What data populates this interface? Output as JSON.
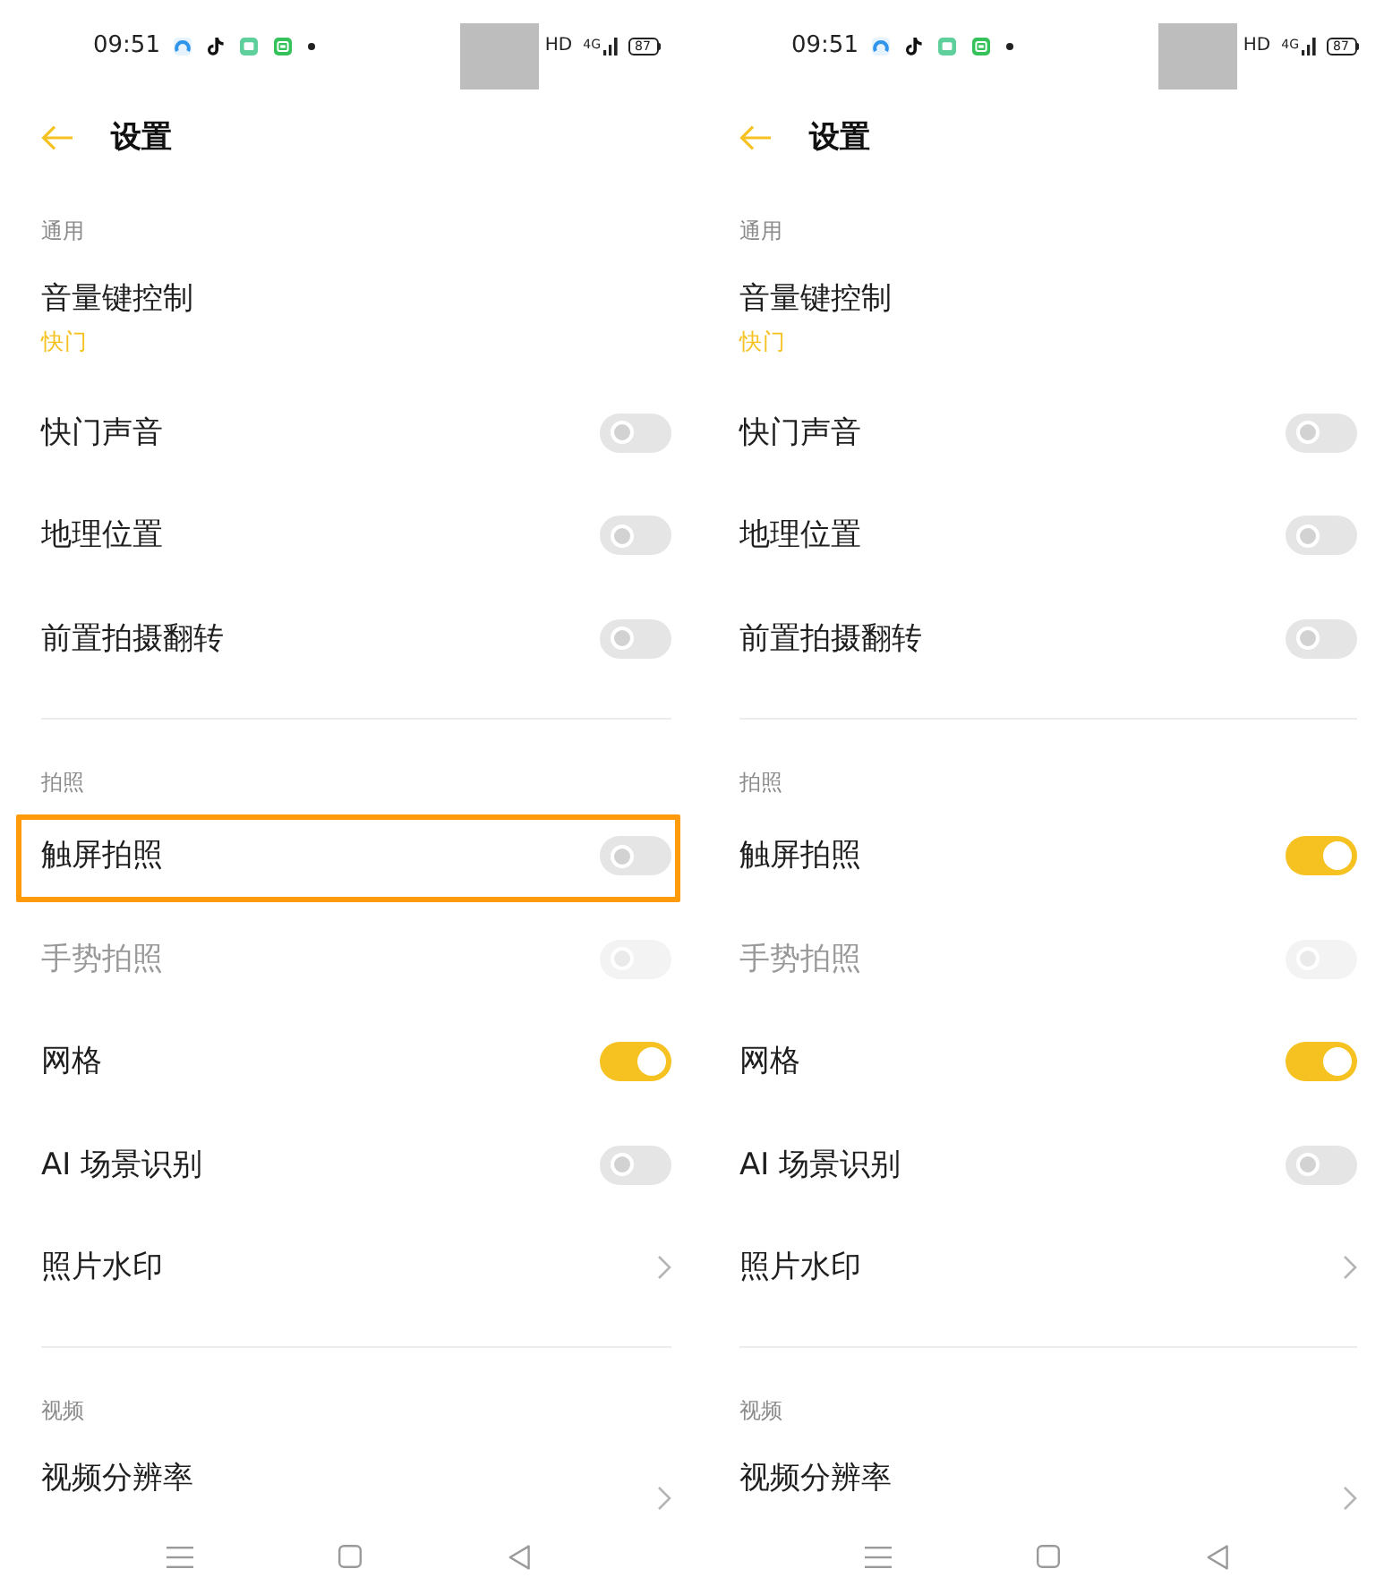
{
  "screens": [
    {
      "status_bar": {
        "time": "09:51",
        "hd": "HD",
        "network": "4G",
        "battery": "87"
      },
      "header": {
        "title": "设置"
      },
      "sections": [
        {
          "title": "通用",
          "items": [
            {
              "kind": "choice",
              "label": "音量键控制",
              "value": "快门",
              "disabled": false,
              "highlighted": false
            },
            {
              "kind": "switch",
              "label": "快门声音",
              "on": false,
              "disabled": false,
              "highlighted": false
            },
            {
              "kind": "switch",
              "label": "地理位置",
              "on": false,
              "disabled": false,
              "highlighted": false
            },
            {
              "kind": "switch",
              "label": "前置拍摄翻转",
              "on": false,
              "disabled": false,
              "highlighted": false
            }
          ]
        },
        {
          "title": "拍照",
          "items": [
            {
              "kind": "switch",
              "label": "触屏拍照",
              "on": false,
              "disabled": false,
              "highlighted": true
            },
            {
              "kind": "switch",
              "label": "手势拍照",
              "on": false,
              "disabled": true,
              "highlighted": false
            },
            {
              "kind": "switch",
              "label": "网格",
              "on": true,
              "disabled": false,
              "highlighted": false
            },
            {
              "kind": "switch",
              "label": "AI 场景识别",
              "on": false,
              "disabled": false,
              "highlighted": false
            },
            {
              "kind": "link",
              "label": "照片水印",
              "disabled": false,
              "highlighted": false
            }
          ]
        },
        {
          "title": "视频",
          "items": [
            {
              "kind": "detail",
              "label": "视频分辨率",
              "disabled": false,
              "highlighted": false
            }
          ]
        }
      ]
    },
    {
      "status_bar": {
        "time": "09:51",
        "hd": "HD",
        "network": "4G",
        "battery": "87"
      },
      "header": {
        "title": "设置"
      },
      "sections": [
        {
          "title": "通用",
          "items": [
            {
              "kind": "choice",
              "label": "音量键控制",
              "value": "快门",
              "disabled": false,
              "highlighted": false
            },
            {
              "kind": "switch",
              "label": "快门声音",
              "on": false,
              "disabled": false,
              "highlighted": false
            },
            {
              "kind": "switch",
              "label": "地理位置",
              "on": false,
              "disabled": false,
              "highlighted": false
            },
            {
              "kind": "switch",
              "label": "前置拍摄翻转",
              "on": false,
              "disabled": false,
              "highlighted": false
            }
          ]
        },
        {
          "title": "拍照",
          "items": [
            {
              "kind": "switch",
              "label": "触屏拍照",
              "on": true,
              "disabled": false,
              "highlighted": false
            },
            {
              "kind": "switch",
              "label": "手势拍照",
              "on": false,
              "disabled": true,
              "highlighted": false
            },
            {
              "kind": "switch",
              "label": "网格",
              "on": true,
              "disabled": false,
              "highlighted": false
            },
            {
              "kind": "switch",
              "label": "AI 场景识别",
              "on": false,
              "disabled": false,
              "highlighted": false
            },
            {
              "kind": "link",
              "label": "照片水印",
              "disabled": false,
              "highlighted": false
            }
          ]
        },
        {
          "title": "视频",
          "items": [
            {
              "kind": "detail",
              "label": "视频分辨率",
              "disabled": false,
              "highlighted": false
            }
          ]
        }
      ]
    }
  ]
}
